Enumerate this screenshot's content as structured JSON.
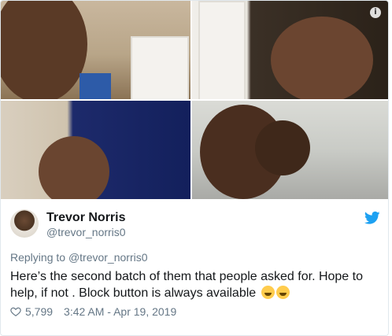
{
  "tweet": {
    "author_name": "Trevor Norris",
    "author_handle": "@trevor_norris0",
    "replying_prefix": "Replying to",
    "replying_handle": "@trevor_norris0",
    "text_line1": "Here’s the second batch of them that people asked for. Hope to",
    "text_line2": "help, if not . Block button is always available",
    "emojis": [
      "face-with-tears-of-joy",
      "face-with-tears-of-joy"
    ],
    "like_count": "5,799",
    "timestamp": "3:42 AM - Apr 19, 2019"
  },
  "media": {
    "images": [
      "photo-1",
      "photo-2",
      "photo-3",
      "photo-4"
    ],
    "info_glyph": "i"
  },
  "colors": {
    "text_primary": "#14171a",
    "text_secondary": "#657786",
    "twitter_blue": "#1da1f2",
    "border": "#e1e8ed"
  }
}
